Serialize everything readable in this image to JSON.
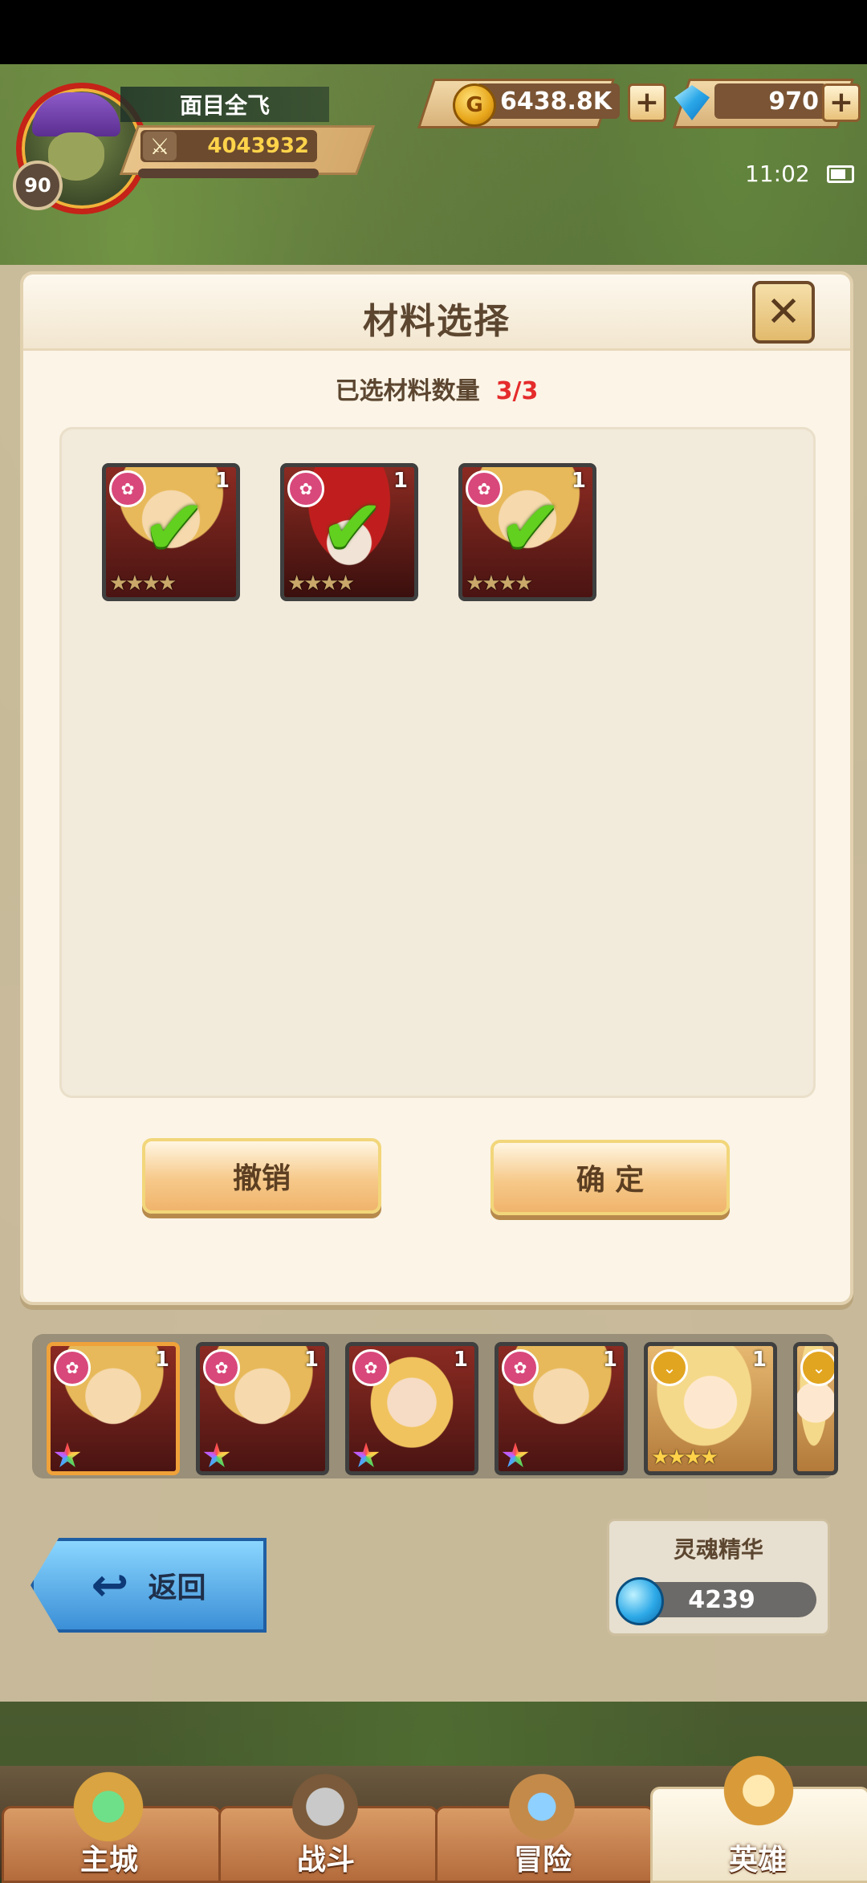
{
  "player": {
    "name": "面目全飞",
    "level": "90",
    "power": "4043932"
  },
  "currency": {
    "gold": "6438.8K",
    "gems": "970"
  },
  "status": {
    "time": "11:02"
  },
  "modal": {
    "title": "材料选择",
    "count_label": "已选材料数量",
    "count_value": "3/3",
    "cancel_label": "撤销",
    "confirm_label": "确 定"
  },
  "selected_materials": [
    {
      "level": "1"
    },
    {
      "level": "1"
    },
    {
      "level": "1"
    }
  ],
  "hero_list": [
    {
      "level": "1"
    },
    {
      "level": "1"
    },
    {
      "level": "1"
    },
    {
      "level": "1"
    },
    {
      "level": "1"
    }
  ],
  "back_label": "返回",
  "soul_essence": {
    "title": "灵魂精华",
    "value": "4239"
  },
  "nav": {
    "main_city": "主城",
    "battle": "战斗",
    "adventure": "冒险",
    "heroes": "英雄"
  }
}
